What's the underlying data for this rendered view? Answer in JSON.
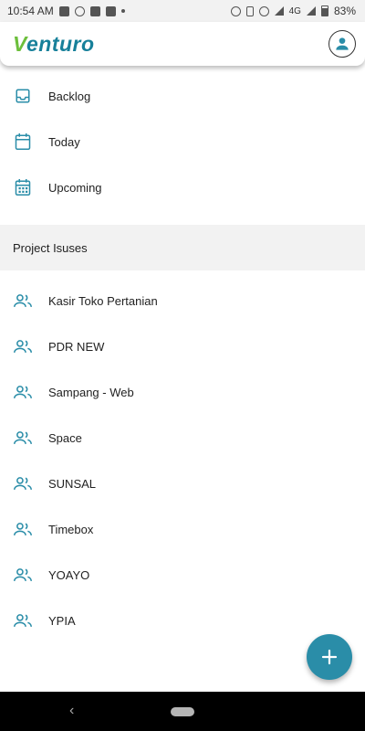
{
  "status_bar": {
    "time": "10:54 AM",
    "network": "4G",
    "battery": "83%"
  },
  "app": {
    "logo": "Venturo"
  },
  "menu": [
    {
      "label": "Backlog",
      "icon": "inbox-icon"
    },
    {
      "label": "Today",
      "icon": "calendar-blank-icon"
    },
    {
      "label": "Upcoming",
      "icon": "calendar-grid-icon"
    }
  ],
  "section": {
    "title": "Project Isuses"
  },
  "projects": [
    {
      "label": "Kasir Toko Pertanian"
    },
    {
      "label": "PDR NEW"
    },
    {
      "label": "Sampang - Web"
    },
    {
      "label": "Space"
    },
    {
      "label": "SUNSAL"
    },
    {
      "label": "Timebox"
    },
    {
      "label": "YOAYO"
    },
    {
      "label": "YPIA"
    }
  ],
  "fab": {
    "icon": "plus-icon"
  },
  "colors": {
    "accent": "#2a8da8",
    "logo_blue": "#17809a",
    "logo_green": "#6cbf3c"
  }
}
